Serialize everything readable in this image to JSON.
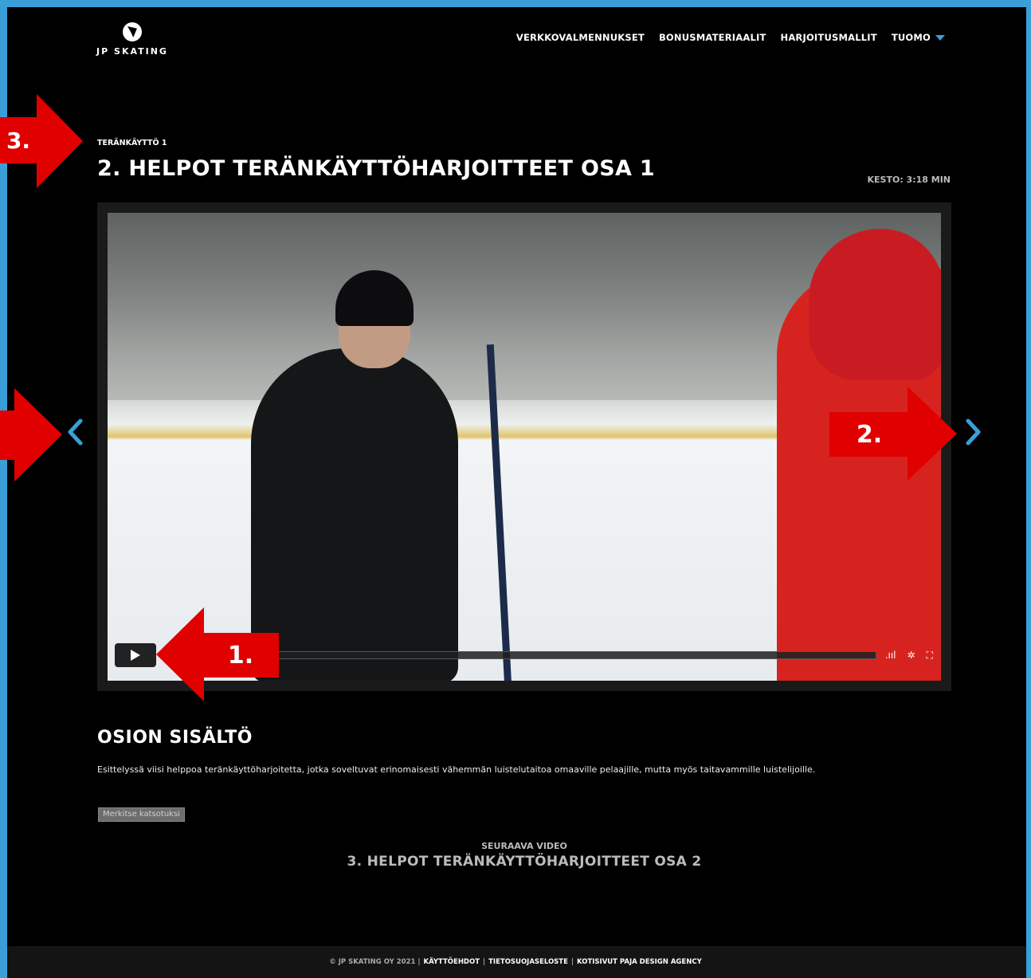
{
  "brand": {
    "logo_text": "JP SKATING",
    "accent_color": "#3a9ed8"
  },
  "nav": {
    "items": [
      {
        "label": "VERKKOVALMENNUKSET"
      },
      {
        "label": "BONUSMATERIAALIT"
      },
      {
        "label": "HARJOITUSMALLIT"
      }
    ],
    "user": {
      "label": "TUOMO",
      "icon": "chevron-down-icon"
    }
  },
  "lesson": {
    "breadcrumb": "TERÄNKÄYTTÖ 1",
    "title": "2. HELPOT TERÄNKÄYTTÖHARJOITTEET OSA 1",
    "duration": "KESTO: 3:18 MIN"
  },
  "video": {
    "controls": {
      "play_icon": "play-icon",
      "volume_icon": "volume-icon",
      "settings_icon": "gear-icon",
      "fullscreen_icon": "fullscreen-icon"
    },
    "volume_symbol": ".ııl",
    "settings_symbol": "✲",
    "fullscreen_symbol": "⛶"
  },
  "carousel": {
    "prev_icon": "chevron-left-icon",
    "next_icon": "chevron-right-icon"
  },
  "annotations": [
    {
      "label": "1."
    },
    {
      "label": "2."
    },
    {
      "label": "3."
    }
  ],
  "section": {
    "title": "OSION SISÄLTÖ",
    "description": "Esittelyssä viisi helppoa teränkäyttöharjoitetta, jotka soveltuvat erinomaisesti vähemmän luistelutaitoa omaaville pelaajille, mutta myös taitavammille luistelijoille.",
    "mark_watched": "Merkitse katsotuksi"
  },
  "next_video": {
    "label": "SEURAAVA VIDEO",
    "title": "3. HELPOT TERÄNKÄYTTÖHARJOITTEET OSA 2"
  },
  "footer": {
    "copyright": "© JP SKATING OY 2021 |",
    "links": [
      "KÄYTTÖEHDOT",
      "TIETOSUOJASELOSTE",
      "KOTISIVUT PAJA DESIGN AGENCY"
    ],
    "separator": "|"
  }
}
